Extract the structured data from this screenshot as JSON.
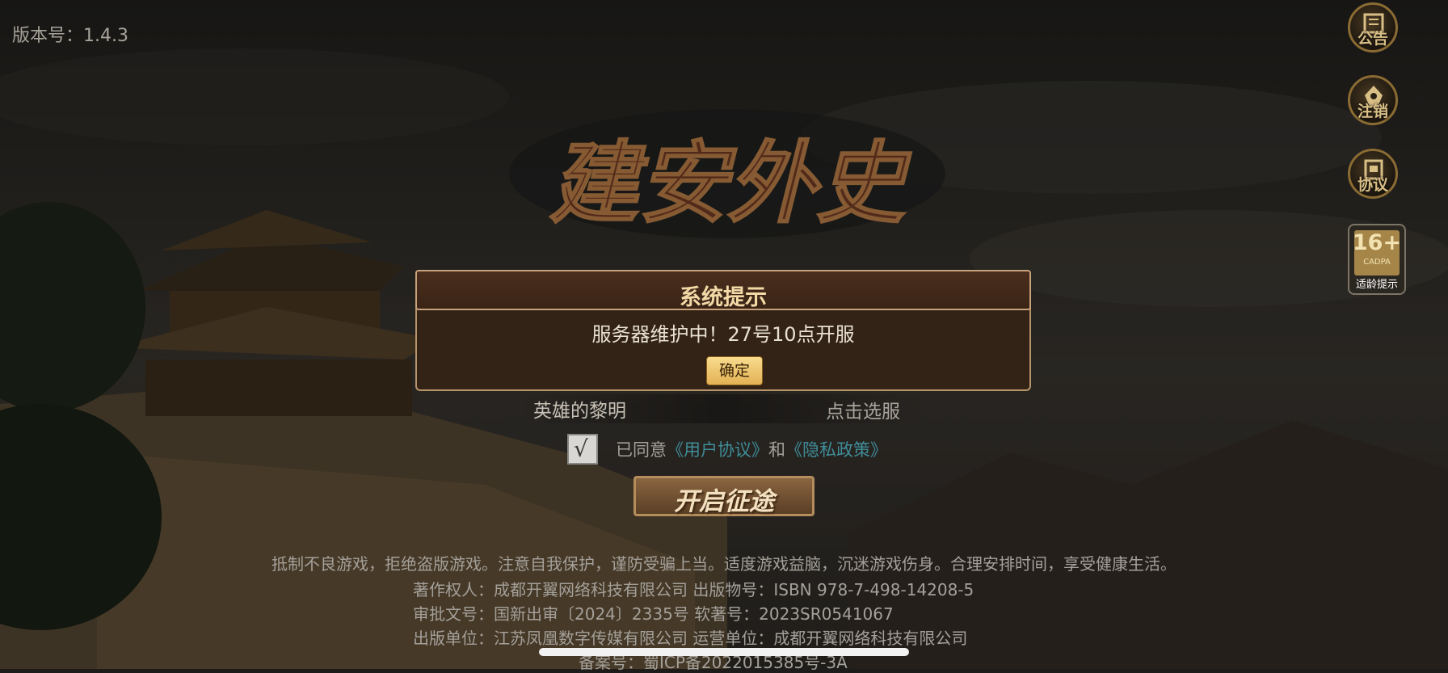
{
  "version_label": "版本号：1.4.3",
  "game_title": "建安外史",
  "side_menu": {
    "notice": "公告",
    "logout": "注销",
    "agreement": "协议"
  },
  "age_rating": {
    "number": "16+",
    "org": "CADPA",
    "label": "适龄提示"
  },
  "dialog": {
    "title": "系统提示",
    "message": "服务器维护中！27号10点开服",
    "confirm": "确定"
  },
  "server": {
    "name": "英雄的黎明",
    "select": "点击选服"
  },
  "consent": {
    "checked": true,
    "check_mark": "√",
    "prefix": "已同意",
    "user_agreement": "《用户协议》",
    "and": "和",
    "privacy_policy": "《隐私政策》"
  },
  "start_button": "开启征途",
  "health_notice": "抵制不良游戏，拒绝盗版游戏。注意自我保护，谨防受骗上当。适度游戏益脑，沉迷游戏伤身。合理安排时间，享受健康生活。",
  "credits": [
    "著作权人：成都开翼网络科技有限公司  出版物号：ISBN 978-7-498-14208-5",
    "审批文号：国新出审〔2024〕2335号    软著号：2023SR0541067",
    "出版单位：江苏凤凰数字传媒有限公司  运营单位：成都开翼网络科技有限公司",
    "备案号：蜀ICP备2022015385号-3A"
  ]
}
